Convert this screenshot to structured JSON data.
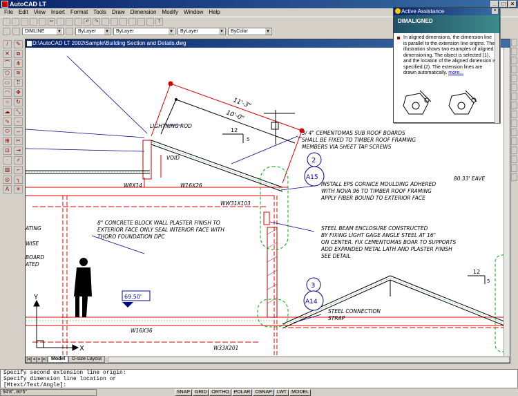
{
  "app_title": "AutoCAD LT",
  "menu": [
    "File",
    "Edit",
    "View",
    "Insert",
    "Format",
    "Tools",
    "Draw",
    "Dimension",
    "Modify",
    "Window",
    "Help"
  ],
  "toolbar2": {
    "layer_value": "DIMLINE",
    "color_value": "ByLayer",
    "linetype_value": "ByLayer",
    "lineweight_value": "ByLayer",
    "plotstyle_value": "ByColor"
  },
  "drawing_window": {
    "title": "D:\\AutoCAD LT 2002\\Sample\\Building Section and Details.dwg"
  },
  "tabs": [
    "Model",
    "D-size Layout"
  ],
  "assist": {
    "title": "Active Assistance",
    "banner": "DIMALIGNED",
    "text": "In aligned dimensions, the dimension line is parallel to the extension line origins. The illustration shows two examples of aligned dimensioning. The object is selected (1), and the location of the aligned dimension is specified (2). The extension lines are drawn automatically.",
    "more": "more..."
  },
  "command_lines": [
    "Specify second extension line origin:",
    "Specify dimension line location or",
    "[Mtext/Text/Angle]:"
  ],
  "status": {
    "coords": "94'8\",     80'5\"",
    "buttons": [
      "SNAP",
      "GRID",
      "ORTHO",
      "POLAR",
      "OSNAP",
      "LWT",
      "MODEL"
    ]
  },
  "drawing": {
    "dim_11_3": "11'-3\"",
    "dim_10_0": "10'-0\"",
    "slope_a": "12",
    "slope_a_rise": "5",
    "slope_b": "12",
    "slope_b_rise": "5",
    "note_lightning": "LIGHTNING ROD",
    "note_void": "VOID",
    "note_roof1": "3/ 4\" CEMENTOMAS SUB ROOF BOARDS",
    "note_roof2": "SHALL BE FIXED TO TIMBER ROOF FRAMING",
    "note_roof3": "MEMBERS VIA SHEET TAP SCREWS",
    "callout_1_num": "2",
    "callout_1_ref": "A15",
    "callout_2_num": "3",
    "callout_2_ref": "A14",
    "note_cornice1": "INSTALL EPS CORNICE MOULDING ADHERED",
    "note_cornice2": "WITH NOVA 96 TO TIMBER ROOF FRAMING",
    "note_cornice3": "APPLY FIBER BOUND TO EXTERIOR FACE",
    "elev_text": "80.33' EAVE",
    "beam_w8x14": "W8X14",
    "beam_w16x26": "W16X26",
    "beam_ww31x103": "WW31X103",
    "note_wall1": "8\" CONCRETE BLOCK WALL PLASTER FINISH TO",
    "note_wall2": "EXTERIOR FACE ONLY SEAL INTERIOR FACE WITH",
    "note_wall3": "THORO FOUNDATION DPC",
    "note_steel1": "STEEL BEAM ENCLOSURE CONSTRUCTED",
    "note_steel2": "BY FIXING LIGHT GAGE ANGLE STEEL AT 16\"",
    "note_steel3": "ON CENTER. FIX CEMENTOMAS BOAR TO SUPPORTS",
    "note_steel4": "ADD EXPANDED METAL LATH AND PLASTER FINISH",
    "note_steel5": "SEE DETAIL",
    "left_frag1": "ATING",
    "left_frag2": "WISE",
    "left_frag3": "BOARD",
    "left_frag4": "ATED",
    "elev_box": "69.50'",
    "beam_w16x36": "W16X36",
    "beam_w33x201": "W33X201",
    "note_conn1": "STEEL CONNECTION",
    "note_conn2": "STRAP",
    "ucs_y": "Y",
    "ucs_x": "X"
  }
}
